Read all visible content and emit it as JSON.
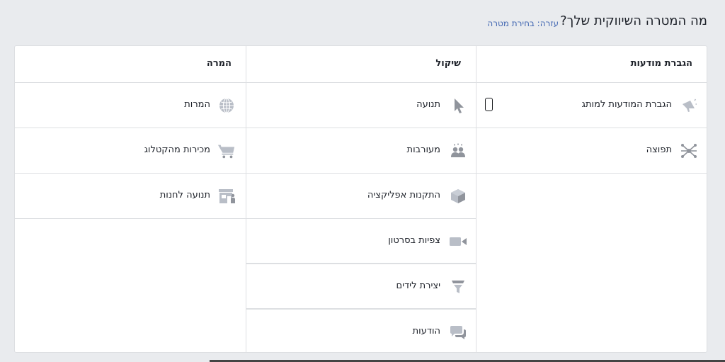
{
  "header": {
    "title": "מה המטרה השיווקית שלך?",
    "help_link": "עזרה: בחירת מטרה"
  },
  "columns": {
    "awareness": {
      "heading": "הגברת מודעות",
      "items": [
        {
          "label": "הגברת המודעות למותג",
          "icon": "megaphone-icon"
        },
        {
          "label": "תפוצה",
          "icon": "reach-icon"
        }
      ]
    },
    "consideration": {
      "heading": "שיקול",
      "items": [
        {
          "label": "תנועה",
          "icon": "cursor-icon"
        },
        {
          "label": "מעורבות",
          "icon": "people-icon"
        },
        {
          "label": "התקנות אפליקציה",
          "icon": "cube-icon"
        },
        {
          "label": "צפיות בסרטון",
          "icon": "video-camera-icon"
        },
        {
          "label": "יצירת לידים",
          "icon": "funnel-icon"
        },
        {
          "label": "הודעות",
          "icon": "chat-bubbles-icon"
        }
      ]
    },
    "conversion": {
      "heading": "המרה",
      "items": [
        {
          "label": "המרות",
          "icon": "globe-icon"
        },
        {
          "label": "מכירות מהקטלוג",
          "icon": "shopping-cart-icon"
        },
        {
          "label": "תנועה לחנות",
          "icon": "store-icon"
        }
      ]
    }
  },
  "colors": {
    "icon": "#90949c",
    "link": "#4267b2",
    "border": "#dddfe2",
    "background": "#e9ebee"
  }
}
